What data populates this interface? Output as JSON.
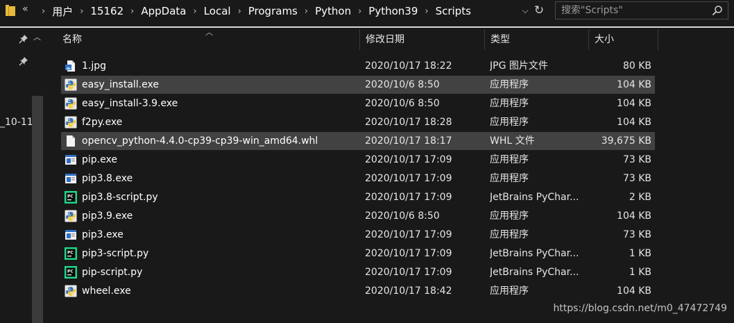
{
  "address_bar": {
    "overflow_label": "«",
    "path": [
      "用户",
      "15162",
      "AppData",
      "Local",
      "Programs",
      "Python",
      "Python39",
      "Scripts"
    ],
    "separator": "›",
    "dropdown_glyph": "⌵",
    "refresh_glyph": "↻"
  },
  "search": {
    "placeholder": "搜索\"Scripts\""
  },
  "nav_pane": {
    "visible_label": "_10-11"
  },
  "columns": {
    "name": "名称",
    "date": "修改日期",
    "type": "类型",
    "size": "大小"
  },
  "files": [
    {
      "name": "1.jpg",
      "date": "2020/10/17 18:22",
      "type": "JPG 图片文件",
      "size": "80 KB",
      "icon": "jpg-file-icon",
      "selected": false
    },
    {
      "name": "easy_install.exe",
      "date": "2020/10/6 8:50",
      "type": "应用程序",
      "size": "104 KB",
      "icon": "python-exe-icon",
      "selected": true
    },
    {
      "name": "easy_install-3.9.exe",
      "date": "2020/10/6 8:50",
      "type": "应用程序",
      "size": "104 KB",
      "icon": "python-exe-icon",
      "selected": false
    },
    {
      "name": "f2py.exe",
      "date": "2020/10/17 18:28",
      "type": "应用程序",
      "size": "104 KB",
      "icon": "python-exe-icon",
      "selected": false
    },
    {
      "name": "opencv_python-4.4.0-cp39-cp39-win_amd64.whl",
      "date": "2020/10/17 18:17",
      "type": "WHL 文件",
      "size": "39,675 KB",
      "icon": "generic-file-icon",
      "selected": true
    },
    {
      "name": "pip.exe",
      "date": "2020/10/17 17:09",
      "type": "应用程序",
      "size": "73 KB",
      "icon": "app-window-icon",
      "selected": false
    },
    {
      "name": "pip3.8.exe",
      "date": "2020/10/17 17:09",
      "type": "应用程序",
      "size": "73 KB",
      "icon": "app-window-icon",
      "selected": false
    },
    {
      "name": "pip3.8-script.py",
      "date": "2020/10/17 17:09",
      "type": "JetBrains PyChar...",
      "size": "2 KB",
      "icon": "pycharm-file-icon",
      "selected": false
    },
    {
      "name": "pip3.9.exe",
      "date": "2020/10/6 8:50",
      "type": "应用程序",
      "size": "104 KB",
      "icon": "python-exe-icon",
      "selected": false
    },
    {
      "name": "pip3.exe",
      "date": "2020/10/17 17:09",
      "type": "应用程序",
      "size": "73 KB",
      "icon": "app-window-icon",
      "selected": false
    },
    {
      "name": "pip3-script.py",
      "date": "2020/10/17 17:09",
      "type": "JetBrains PyChar...",
      "size": "1 KB",
      "icon": "pycharm-file-icon",
      "selected": false
    },
    {
      "name": "pip-script.py",
      "date": "2020/10/17 17:09",
      "type": "JetBrains PyChar...",
      "size": "1 KB",
      "icon": "pycharm-file-icon",
      "selected": false
    },
    {
      "name": "wheel.exe",
      "date": "2020/10/17 18:42",
      "type": "应用程序",
      "size": "104 KB",
      "icon": "python-exe-icon",
      "selected": false
    }
  ],
  "watermark": "https://blog.csdn.net/m0_47472749",
  "colors": {
    "background": "#191919",
    "selected_row": "#424242",
    "folder_yellow": "#e8b93b",
    "python_blue": "#3a74b4",
    "python_yellow": "#f3c93c",
    "pycharm_green": "#21d789"
  }
}
